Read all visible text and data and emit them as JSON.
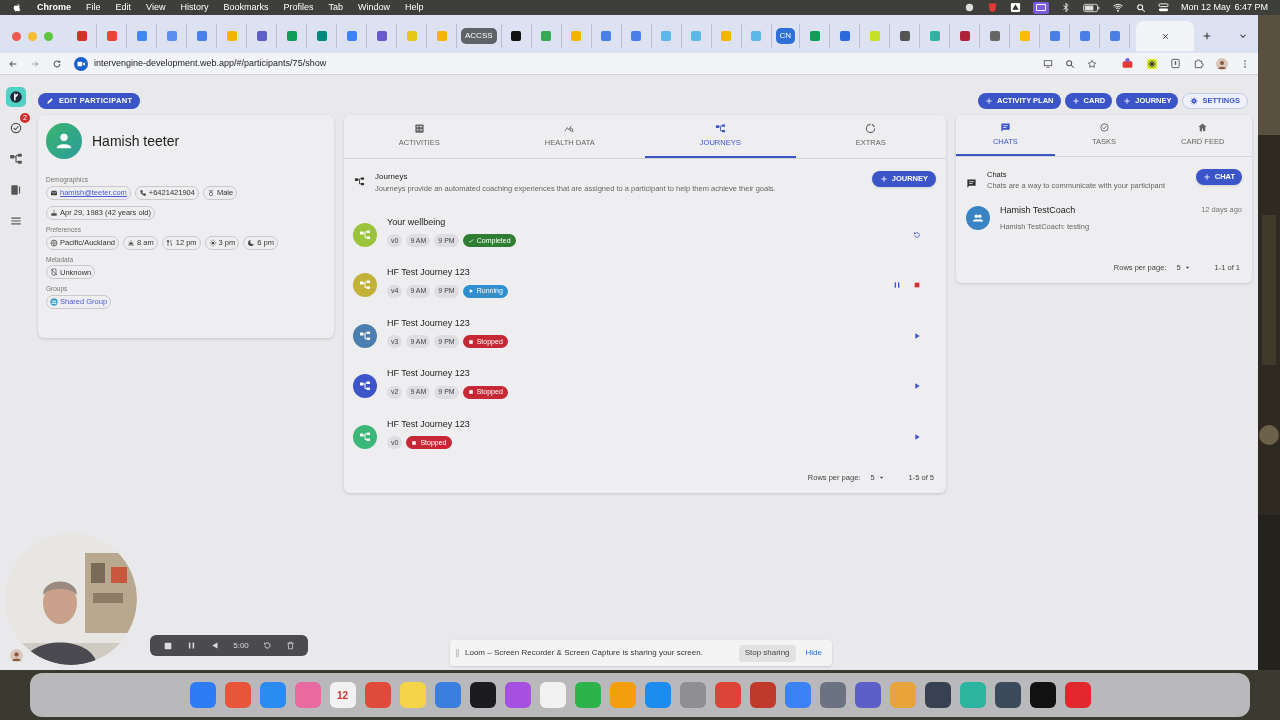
{
  "menubar": {
    "app": "Chrome",
    "menus": [
      "File",
      "Edit",
      "View",
      "History",
      "Bookmarks",
      "Profiles",
      "Tab",
      "Window",
      "Help"
    ],
    "date": "Mon 12 May",
    "time": "6:47 PM"
  },
  "browser": {
    "tabs": [
      {
        "color": "#d93025",
        "selected": false
      },
      {
        "color": "#ea4335",
        "selected": false
      },
      {
        "color": "#4285f4",
        "selected": false
      },
      {
        "color": "#5b8def",
        "selected": false
      },
      {
        "color": "#4a7fe8",
        "selected": false
      },
      {
        "color": "#f4b400",
        "selected": false
      },
      {
        "color": "#5b5fc7",
        "selected": false
      },
      {
        "color": "#0f9d58",
        "selected": false
      },
      {
        "color": "#00897b",
        "selected": false
      },
      {
        "color": "#3b82f6",
        "selected": false
      },
      {
        "color": "#6a5acd",
        "selected": false
      },
      {
        "color": "#e6c619",
        "selected": false
      },
      {
        "color": "#f4b400",
        "selected": false
      },
      {
        "label": "ACCSS",
        "color": "#5f6368",
        "selected": false
      },
      {
        "color": "#111111",
        "selected": false
      },
      {
        "color": "#34a853",
        "selected": false
      },
      {
        "color": "#f4b400",
        "selected": false
      },
      {
        "color": "#4a7fe8",
        "selected": false
      },
      {
        "color": "#4a7fe8",
        "selected": false
      },
      {
        "color": "#5bb8e8",
        "selected": false
      },
      {
        "color": "#5bb8e8",
        "selected": false
      },
      {
        "color": "#f4b400",
        "selected": false
      },
      {
        "color": "#5bb8e8",
        "selected": false
      },
      {
        "label": "CN",
        "color": "#2f6fd8",
        "selected": false
      },
      {
        "color": "#0f9d58",
        "selected": false
      },
      {
        "color": "#2a6ad8",
        "selected": false
      },
      {
        "color": "#c6e02a",
        "selected": false
      },
      {
        "color": "#555555",
        "selected": false
      },
      {
        "color": "#2bb5a0",
        "selected": false
      },
      {
        "color": "#b0213a",
        "selected": false
      },
      {
        "color": "#666666",
        "selected": false
      },
      {
        "color": "#fbbc04",
        "selected": false
      },
      {
        "color": "#4a7fe8",
        "selected": false
      },
      {
        "color": "#4a7fe8",
        "selected": false
      },
      {
        "color": "#4a7fe8",
        "selected": false
      },
      {
        "selected": true
      }
    ],
    "address": "intervengine-development.web.app/#/participants/75/show"
  },
  "rail": [
    {
      "kind": "logo",
      "selected": true
    },
    {
      "kind": "tasks",
      "badge": "2",
      "selected": false
    },
    {
      "kind": "journeys",
      "selected": false
    },
    {
      "kind": "cards",
      "selected": false
    },
    {
      "kind": "menu",
      "selected": false
    }
  ],
  "edit_button": "EDIT PARTICIPANT",
  "participant": {
    "name": "Hamish teeter",
    "sections": [
      {
        "label": "Demographics",
        "chips": [
          {
            "kind": "email",
            "text": "hamish@teeter.com"
          },
          {
            "kind": "phone",
            "text": "+6421421904"
          },
          {
            "kind": "gender",
            "text": "Male"
          },
          {
            "kind": "birthday",
            "text": "Apr 29, 1983 (42 years old)"
          }
        ]
      },
      {
        "label": "Preferences",
        "chips": [
          {
            "kind": "timezone",
            "text": "Pacific/Auckland"
          },
          {
            "kind": "wake",
            "text": "8 am"
          },
          {
            "kind": "meal",
            "text": "12 pm"
          },
          {
            "kind": "afternoon",
            "text": "3 pm"
          },
          {
            "kind": "sleep",
            "text": "6 pm"
          }
        ]
      },
      {
        "label": "Metadata",
        "chips": [
          {
            "kind": "device",
            "text": "Unknown"
          }
        ]
      },
      {
        "label": "Groups",
        "chips": [
          {
            "kind": "group",
            "text": "Shared Group"
          }
        ]
      }
    ]
  },
  "header_buttons": [
    {
      "kind": "add",
      "label": "ACTIVITY PLAN"
    },
    {
      "kind": "add",
      "label": "CARD"
    },
    {
      "kind": "add",
      "label": "JOURNEY"
    },
    {
      "kind": "settings",
      "label": "SETTINGS"
    }
  ],
  "center_tabs": [
    {
      "kind": "activities",
      "label": "ACTIVITIES",
      "selected": false
    },
    {
      "kind": "health",
      "label": "HEALTH DATA",
      "selected": false
    },
    {
      "kind": "journeys",
      "label": "JOURNEYS",
      "selected": true
    },
    {
      "kind": "extras",
      "label": "EXTRAS",
      "selected": false
    }
  ],
  "journeys": {
    "title": "Journeys",
    "description": "Journeys provide an automated coaching experiences that are assigned to a participant to help them achieve their goals.",
    "add_button": "JOURNEY",
    "rows": [
      {
        "name": "Your wellbeing",
        "color": "#9bc43c",
        "chips": [
          "v0",
          "9 AM",
          "9 PM"
        ],
        "status": {
          "kind": "completed",
          "label": "Completed"
        },
        "actions": [
          {
            "kind": "restart"
          }
        ]
      },
      {
        "name": "HF Test Journey 123",
        "color": "#c2b238",
        "chips": [
          "v4",
          "9 AM",
          "9 PM"
        ],
        "status": {
          "kind": "running",
          "label": "Running"
        },
        "actions": [
          {
            "kind": "pause"
          },
          {
            "kind": "stop"
          }
        ]
      },
      {
        "name": "HF Test Journey 123",
        "color": "#4a7fb0",
        "chips": [
          "v3",
          "9 AM",
          "9 PM"
        ],
        "status": {
          "kind": "stopped",
          "label": "Stopped"
        },
        "actions": [
          {
            "kind": "play"
          }
        ]
      },
      {
        "name": "HF Test Journey 123",
        "color": "#3d55c8",
        "chips": [
          "v2",
          "9 AM",
          "9 PM"
        ],
        "status": {
          "kind": "stopped",
          "label": "Stopped"
        },
        "actions": [
          {
            "kind": "play"
          }
        ]
      },
      {
        "name": "HF Test Journey 123",
        "color": "#3bb77a",
        "chips": [
          "v0"
        ],
        "status": {
          "kind": "stopped",
          "label": "Stopped"
        },
        "actions": [
          {
            "kind": "play"
          }
        ]
      }
    ],
    "rows_per_page_label": "Rows per page:",
    "rows_per_page": "5",
    "range": "1-5 of 5"
  },
  "right_tabs": [
    {
      "kind": "chats",
      "label": "CHATS",
      "selected": true
    },
    {
      "kind": "tasks",
      "label": "TASKS",
      "selected": false
    },
    {
      "kind": "home",
      "label": "CARD FEED",
      "selected": false
    }
  ],
  "chats": {
    "title": "Chats",
    "description": "Chats are a way to communicate with your participant",
    "add_button": "CHAT",
    "items": [
      {
        "name": "Hamish TestCoach",
        "preview": "Hamish TestCoach: testing",
        "time": "12 days ago"
      }
    ],
    "rows_per_page_label": "Rows per page:",
    "rows_per_page": "5",
    "range": "1-1 of 1"
  },
  "recorder": {
    "time": "5:00"
  },
  "loom": {
    "message": "Loom – Screen Recorder & Screen Capture is sharing your screen.",
    "stop_button": "Stop sharing",
    "hide_link": "Hide"
  },
  "dock": [
    {
      "color": "#2d7cf6"
    },
    {
      "color": "#e9553a"
    },
    {
      "color": "#2a8cf0"
    },
    {
      "color": "#e86aa0"
    },
    {
      "color": "#f2f2f2",
      "label": "12"
    },
    {
      "color": "#e04a3a"
    },
    {
      "color": "#f5d547"
    },
    {
      "color": "#3a7ee0"
    },
    {
      "color": "#1c1c1e"
    },
    {
      "color": "#a550e0"
    },
    {
      "color": "#f2f2f2"
    },
    {
      "color": "#2cb34a"
    },
    {
      "color": "#f59e0b"
    },
    {
      "color": "#1d8cf0"
    },
    {
      "color": "#8e8e93"
    },
    {
      "color": "#db4437"
    },
    {
      "color": "#c0392b"
    },
    {
      "color": "#3b82f6"
    },
    {
      "color": "#6b7280"
    },
    {
      "color": "#5b5fc7"
    },
    {
      "color": "#e8a33a"
    },
    {
      "color": "#374151"
    },
    {
      "color": "#2bb5a0"
    },
    {
      "color": "#3a4a5a"
    },
    {
      "color": "#111111"
    },
    {
      "color": "#e0282e"
    }
  ]
}
